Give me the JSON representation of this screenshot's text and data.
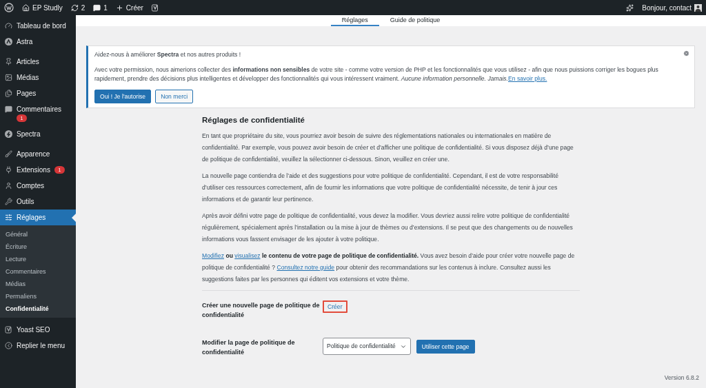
{
  "admin_bar": {
    "items": [
      {
        "kind": "wp"
      },
      {
        "kind": "site",
        "label": "EP Studly"
      },
      {
        "kind": "updates",
        "label": "2"
      },
      {
        "kind": "comments",
        "label": "1"
      },
      {
        "kind": "new",
        "label": "Créer"
      },
      {
        "kind": "yoast"
      }
    ],
    "greeting": "Bonjour, contact"
  },
  "sidebar": {
    "items": [
      {
        "kind": "dashboard",
        "label": "Tableau de bord",
        "selected": false
      },
      {
        "kind": "astra",
        "label": "Astra",
        "selected": false
      },
      {
        "kind": "pin",
        "label": "Articles",
        "selected": false
      },
      {
        "kind": "media",
        "label": "Médias",
        "selected": false
      },
      {
        "kind": "pages",
        "label": "Pages",
        "selected": false
      },
      {
        "kind": "comment",
        "label": "Commentaires",
        "badge": "1",
        "selected": false
      },
      {
        "kind": "spectra",
        "label": "Spectra",
        "selected": false
      },
      {
        "kind": "brush",
        "label": "Apparence",
        "selected": false
      },
      {
        "kind": "plug",
        "label": "Extensions",
        "badge": "1",
        "selected": false
      },
      {
        "kind": "user",
        "label": "Comptes",
        "selected": false
      },
      {
        "kind": "wrench",
        "label": "Outils",
        "selected": false
      },
      {
        "kind": "settings",
        "label": "Réglages",
        "selected": true,
        "children": [
          {
            "label": "Général",
            "selected": false
          },
          {
            "label": "Écriture",
            "selected": false
          },
          {
            "label": "Lecture",
            "selected": false
          },
          {
            "label": "Commentaires",
            "selected": false
          },
          {
            "label": "Médias",
            "selected": false
          },
          {
            "label": "Permaliens",
            "selected": false
          },
          {
            "label": "Confidentialité",
            "selected": true
          }
        ]
      },
      {
        "kind": "yoast",
        "label": "Yoast SEO",
        "selected": false
      },
      {
        "kind": "collapse",
        "label": "Replier le menu",
        "selected": false
      }
    ]
  },
  "tabs": [
    {
      "label": "Réglages",
      "selected": true
    },
    {
      "label": "Guide de politique",
      "selected": false
    }
  ],
  "notice": {
    "title": "Aidez-nous à améliorer **Spectra** et nos autres produits !",
    "body": "Avec votre permission, nous aimerions collecter des **informations non sensibles** de votre site - comme votre version de PHP et les fonctionnalités que vous utilisez - afin que nous puissions corriger les bogues plus rapidement, prendre des décisions plus intelligentes et développer des fonctionnalités qui vous intéressent vraiment. *Aucune information personnelle. Jamais.*",
    "link": "En savoir plus.",
    "buttons": [
      {
        "label": "Oui ! Je l'autorise",
        "kind": "primary"
      },
      {
        "label": "Non merci",
        "kind": "secondary"
      }
    ]
  },
  "section": {
    "heading": "Réglages de confidentialité",
    "paragraphs": [
      "En tant que propriétaire du site, vous pourriez avoir besoin de suivre des réglementations nationales ou internationales en matière de confidentialité. Par exemple, vous pouvez avoir besoin de créer et d’afficher une politique de confidentialité. Si vous disposez déjà d’une page de politique de confidentialité, veuillez la sélectionner ci-dessous. Sinon, veuillez en créer une.",
      "La nouvelle page contiendra de l’aide et des suggestions pour votre politique de confidentialité. Cependant, il est de votre responsabilité d’utiliser ces ressources correctement, afin de fournir les informations que votre politique de confidentialité nécessite, de tenir à jour ces informations et de garantir leur pertinence.",
      "Après avoir défini votre page de politique de confidentialité, vous devez la modifier. Vous devriez aussi relire votre politique de confidentialité régulièrement, spécialement après l’installation ou la mise à jour de thèmes ou d’extensions. Il se peut que des changements ou de nouvelles informations vous fassent envisager de les ajouter à votre politique."
    ],
    "help": [
      {
        "kind": "link",
        "text": "Modifiez"
      },
      {
        "kind": "bold",
        "text": " ou "
      },
      {
        "kind": "link",
        "text": "visualisez"
      },
      {
        "kind": "bold",
        "text": " le contenu de votre page de politique de confidentialité."
      },
      {
        "kind": "text",
        "text": " Vous avez besoin d’aide pour créer votre nouvelle page de politique de confidentialité ? "
      },
      {
        "kind": "link",
        "text": "Consultez notre guide"
      },
      {
        "kind": "text",
        "text": " pour obtenir des recommandations sur les contenus à inclure. Consultez aussi les suggestions faites par les personnes qui éditent vos extensions et votre thème."
      }
    ]
  },
  "form": [
    {
      "kind": "create",
      "label": "Créer une nouvelle page de politique de confidentialité",
      "button": "Créer",
      "highlighted": true
    },
    {
      "kind": "select",
      "label": "Modifier la page de politique de confidentialité",
      "value": "Politique de confidentialité",
      "button": "Utiliser cette page"
    }
  ],
  "footer": {
    "version": "Version 6.8.2"
  }
}
